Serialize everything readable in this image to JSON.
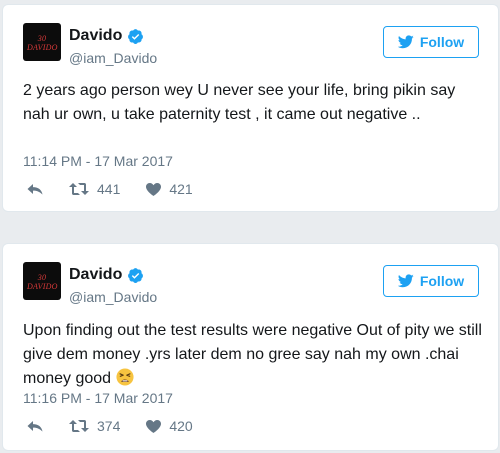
{
  "tweets": [
    {
      "author_name": "Davido",
      "handle": "@iam_Davido",
      "avatar_text": "30\nDAVIDO",
      "follow_label": "Follow",
      "text": "2 years ago person wey U never see your life, bring pikin say nah ur own, u take paternity test , it came out negative ..",
      "emoji": "",
      "timestamp": "11:14 PM - 17 Mar 2017",
      "retweets": "441",
      "likes": "421"
    },
    {
      "author_name": "Davido",
      "handle": "@iam_Davido",
      "avatar_text": "30\nDAVIDO",
      "follow_label": "Follow",
      "text": "Upon finding out the test results were negative Out of pity we still give dem money .yrs later dem no gree say nah my own .chai money good",
      "emoji": "tired-face-emoji",
      "timestamp": "11:16 PM - 17 Mar 2017",
      "retweets": "374",
      "likes": "420"
    }
  ],
  "colors": {
    "accent": "#1da1f2",
    "muted": "#657786",
    "text": "#14171a",
    "avatar_bg": "#0c0c0c",
    "avatar_logo": "#d83a3a",
    "emoji_face": "#f7c440"
  },
  "icons": [
    "verified-badge-icon",
    "twitter-bird-icon",
    "reply-icon",
    "retweet-icon",
    "heart-icon"
  ]
}
